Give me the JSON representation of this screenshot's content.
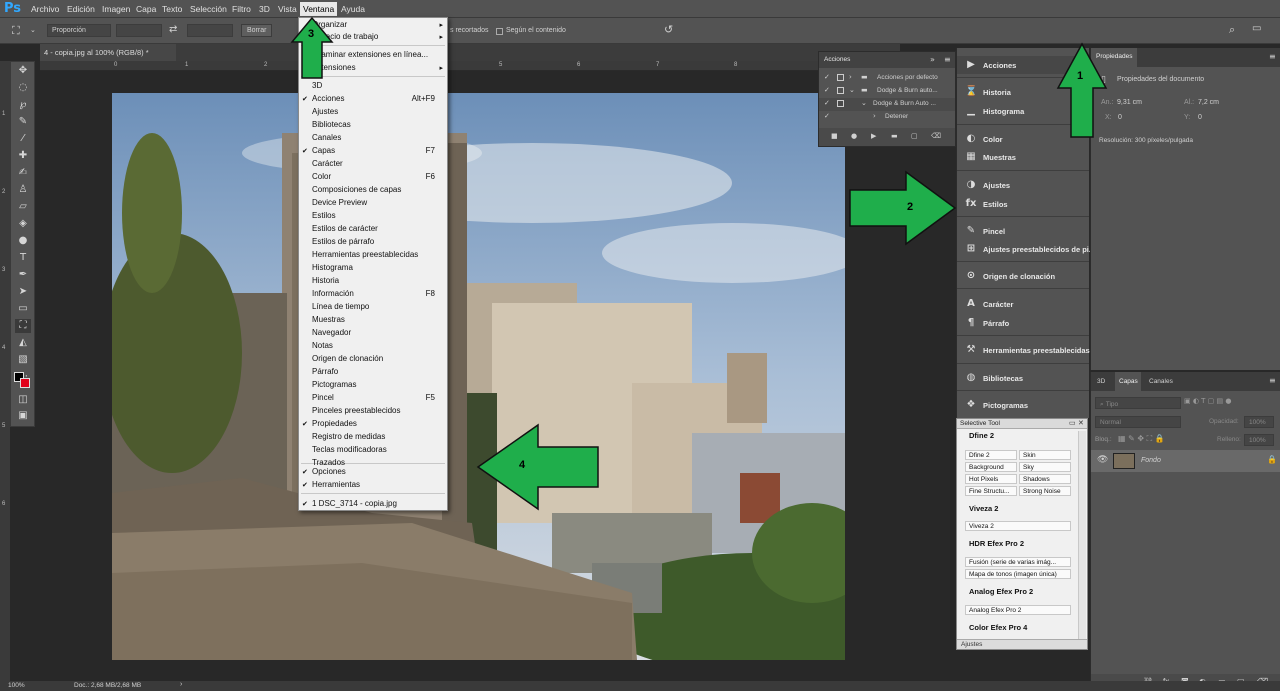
{
  "app": {
    "logo": "Ps",
    "accent": "#31a8ff"
  },
  "menubar": {
    "items": [
      "Archivo",
      "Edición",
      "Imagen",
      "Capa",
      "Texto",
      "Selección",
      "Filtro",
      "3D",
      "Vista",
      "Ventana",
      "Ayuda"
    ],
    "active": "Ventana"
  },
  "options_bar": {
    "ratio_value": "Proporción",
    "clear_label": "Borrar",
    "delete_cropped": "s recortados",
    "content_aware": "Según el contenido"
  },
  "document": {
    "tab_title": "4 - copia.jpg al 100% (RGB/8) *"
  },
  "ruler": {
    "h_ticks": [
      "0",
      "1",
      "2",
      "3",
      "4",
      "5",
      "6",
      "7",
      "8"
    ],
    "v_ticks": [
      "1",
      "2",
      "3",
      "4",
      "5",
      "6"
    ]
  },
  "ventana_menu": {
    "items": [
      {
        "label": "Organizar",
        "shortcut": "",
        "checked": false,
        "submenu": true
      },
      {
        "label": "Espacio de trabajo",
        "shortcut": "",
        "checked": false,
        "submenu": true
      },
      {
        "label": "Examinar extensiones en línea...",
        "shortcut": "",
        "checked": false,
        "submenu": false
      },
      {
        "label": "Extensiones",
        "shortcut": "",
        "checked": false,
        "submenu": true
      },
      {
        "label": "3D",
        "shortcut": "",
        "checked": false,
        "submenu": false
      },
      {
        "label": "Acciones",
        "shortcut": "Alt+F9",
        "checked": true,
        "submenu": false
      },
      {
        "label": "Ajustes",
        "shortcut": "",
        "checked": false,
        "submenu": false
      },
      {
        "label": "Bibliotecas",
        "shortcut": "",
        "checked": false,
        "submenu": false
      },
      {
        "label": "Canales",
        "shortcut": "",
        "checked": false,
        "submenu": false
      },
      {
        "label": "Capas",
        "shortcut": "F7",
        "checked": true,
        "submenu": false
      },
      {
        "label": "Carácter",
        "shortcut": "",
        "checked": false,
        "submenu": false
      },
      {
        "label": "Color",
        "shortcut": "F6",
        "checked": false,
        "submenu": false
      },
      {
        "label": "Composiciones de capas",
        "shortcut": "",
        "checked": false,
        "submenu": false
      },
      {
        "label": "Device Preview",
        "shortcut": "",
        "checked": false,
        "submenu": false
      },
      {
        "label": "Estilos",
        "shortcut": "",
        "checked": false,
        "submenu": false
      },
      {
        "label": "Estilos de carácter",
        "shortcut": "",
        "checked": false,
        "submenu": false
      },
      {
        "label": "Estilos de párrafo",
        "shortcut": "",
        "checked": false,
        "submenu": false
      },
      {
        "label": "Herramientas preestablecidas",
        "shortcut": "",
        "checked": false,
        "submenu": false
      },
      {
        "label": "Histograma",
        "shortcut": "",
        "checked": false,
        "submenu": false
      },
      {
        "label": "Historia",
        "shortcut": "",
        "checked": false,
        "submenu": false
      },
      {
        "label": "Información",
        "shortcut": "F8",
        "checked": false,
        "submenu": false
      },
      {
        "label": "Línea de tiempo",
        "shortcut": "",
        "checked": false,
        "submenu": false
      },
      {
        "label": "Muestras",
        "shortcut": "",
        "checked": false,
        "submenu": false
      },
      {
        "label": "Navegador",
        "shortcut": "",
        "checked": false,
        "submenu": false
      },
      {
        "label": "Notas",
        "shortcut": "",
        "checked": false,
        "submenu": false
      },
      {
        "label": "Origen de clonación",
        "shortcut": "",
        "checked": false,
        "submenu": false
      },
      {
        "label": "Párrafo",
        "shortcut": "",
        "checked": false,
        "submenu": false
      },
      {
        "label": "Pictogramas",
        "shortcut": "",
        "checked": false,
        "submenu": false
      },
      {
        "label": "Pincel",
        "shortcut": "F5",
        "checked": false,
        "submenu": false
      },
      {
        "label": "Pinceles preestablecidos",
        "shortcut": "",
        "checked": false,
        "submenu": false
      },
      {
        "label": "Propiedades",
        "shortcut": "",
        "checked": true,
        "submenu": false
      },
      {
        "label": "Registro de medidas",
        "shortcut": "",
        "checked": false,
        "submenu": false
      },
      {
        "label": "Teclas modificadoras",
        "shortcut": "",
        "checked": false,
        "submenu": false
      },
      {
        "label": "Trazados",
        "shortcut": "",
        "checked": false,
        "submenu": false
      },
      {
        "label": "Opciones",
        "shortcut": "",
        "checked": true,
        "submenu": false
      },
      {
        "label": "Herramientas",
        "shortcut": "",
        "checked": true,
        "submenu": false
      },
      {
        "label": "1 DSC_3714 - copia.jpg",
        "shortcut": "",
        "checked": true,
        "submenu": false
      }
    ]
  },
  "acciones_panel": {
    "title": "Acciones",
    "rows": [
      "Acciones por defecto",
      "Dodge & Burn auto...",
      "Dodge & Burn Auto ...",
      "Detener"
    ]
  },
  "dock": {
    "items": [
      {
        "label": "Acciones",
        "icon": "play-icon"
      },
      {
        "label": "Historia",
        "icon": "history-icon"
      },
      {
        "label": "Histograma",
        "icon": "histogram-icon"
      },
      {
        "label": "Color",
        "icon": "color-icon"
      },
      {
        "label": "Muestras",
        "icon": "swatches-icon"
      },
      {
        "label": "Ajustes",
        "icon": "adjustments-icon"
      },
      {
        "label": "Estilos",
        "icon": "styles-icon"
      },
      {
        "label": "Pincel",
        "icon": "brush-icon"
      },
      {
        "label": "Ajustes preestablecidos de pi...",
        "icon": "brush-presets-icon"
      },
      {
        "label": "Origen de clonación",
        "icon": "clone-source-icon"
      },
      {
        "label": "Carácter",
        "icon": "character-icon"
      },
      {
        "label": "Párrafo",
        "icon": "paragraph-icon"
      },
      {
        "label": "Herramientas preestablecidas",
        "icon": "tool-presets-icon"
      },
      {
        "label": "Bibliotecas",
        "icon": "libraries-icon"
      },
      {
        "label": "Pictogramas",
        "icon": "glyphs-icon"
      }
    ]
  },
  "properties_panel": {
    "tab": "Propiedades",
    "doc_label": "Propiedades del documento",
    "width_label": "An.:",
    "width_value": "9,31 cm",
    "height_label": "Al.:",
    "height_value": "7,2 cm",
    "x_label": "X:",
    "x_value": "0",
    "y_label": "Y:",
    "y_value": "0",
    "resolution": "Resolución: 300 píxeles/pulgada"
  },
  "layers_panel": {
    "tabs": [
      "3D",
      "Capas",
      "Canales"
    ],
    "active_tab": "Capas",
    "search_placeholder": "Tipo",
    "blend_mode": "Normal",
    "opacity_label": "Opacidad:",
    "opacity_value": "100%",
    "lock_label": "Bloq.:",
    "fill_label": "Relleno:",
    "fill_value": "100%",
    "layer_name": "Fondo"
  },
  "selective_tool": {
    "title": "Selective Tool",
    "sections": [
      {
        "name": "Dfine 2",
        "buttons": [
          "Dfine 2",
          "Skin",
          "Background",
          "Sky",
          "Hot Pixels",
          "Shadows",
          "Fine Structu...",
          "Strong Noise"
        ]
      },
      {
        "name": "Viveza 2",
        "buttons": [
          "Viveza 2"
        ]
      },
      {
        "name": "HDR Efex Pro 2",
        "buttons": [
          "Fusión (serie de varias imág...",
          "Mapa de tonos (imagen única)"
        ]
      },
      {
        "name": "Analog Efex Pro 2",
        "buttons": [
          "Analog Efex Pro 2"
        ]
      },
      {
        "name": "Color Efex Pro 4",
        "buttons": []
      }
    ],
    "footer": "Ajustes"
  },
  "status": {
    "zoom": "100%",
    "doc": "Doc.: 2,68 MB/2,68 MB"
  },
  "annotations": {
    "arrow_color": "#1fae4b",
    "labels": [
      "1",
      "2",
      "3",
      "4"
    ]
  }
}
